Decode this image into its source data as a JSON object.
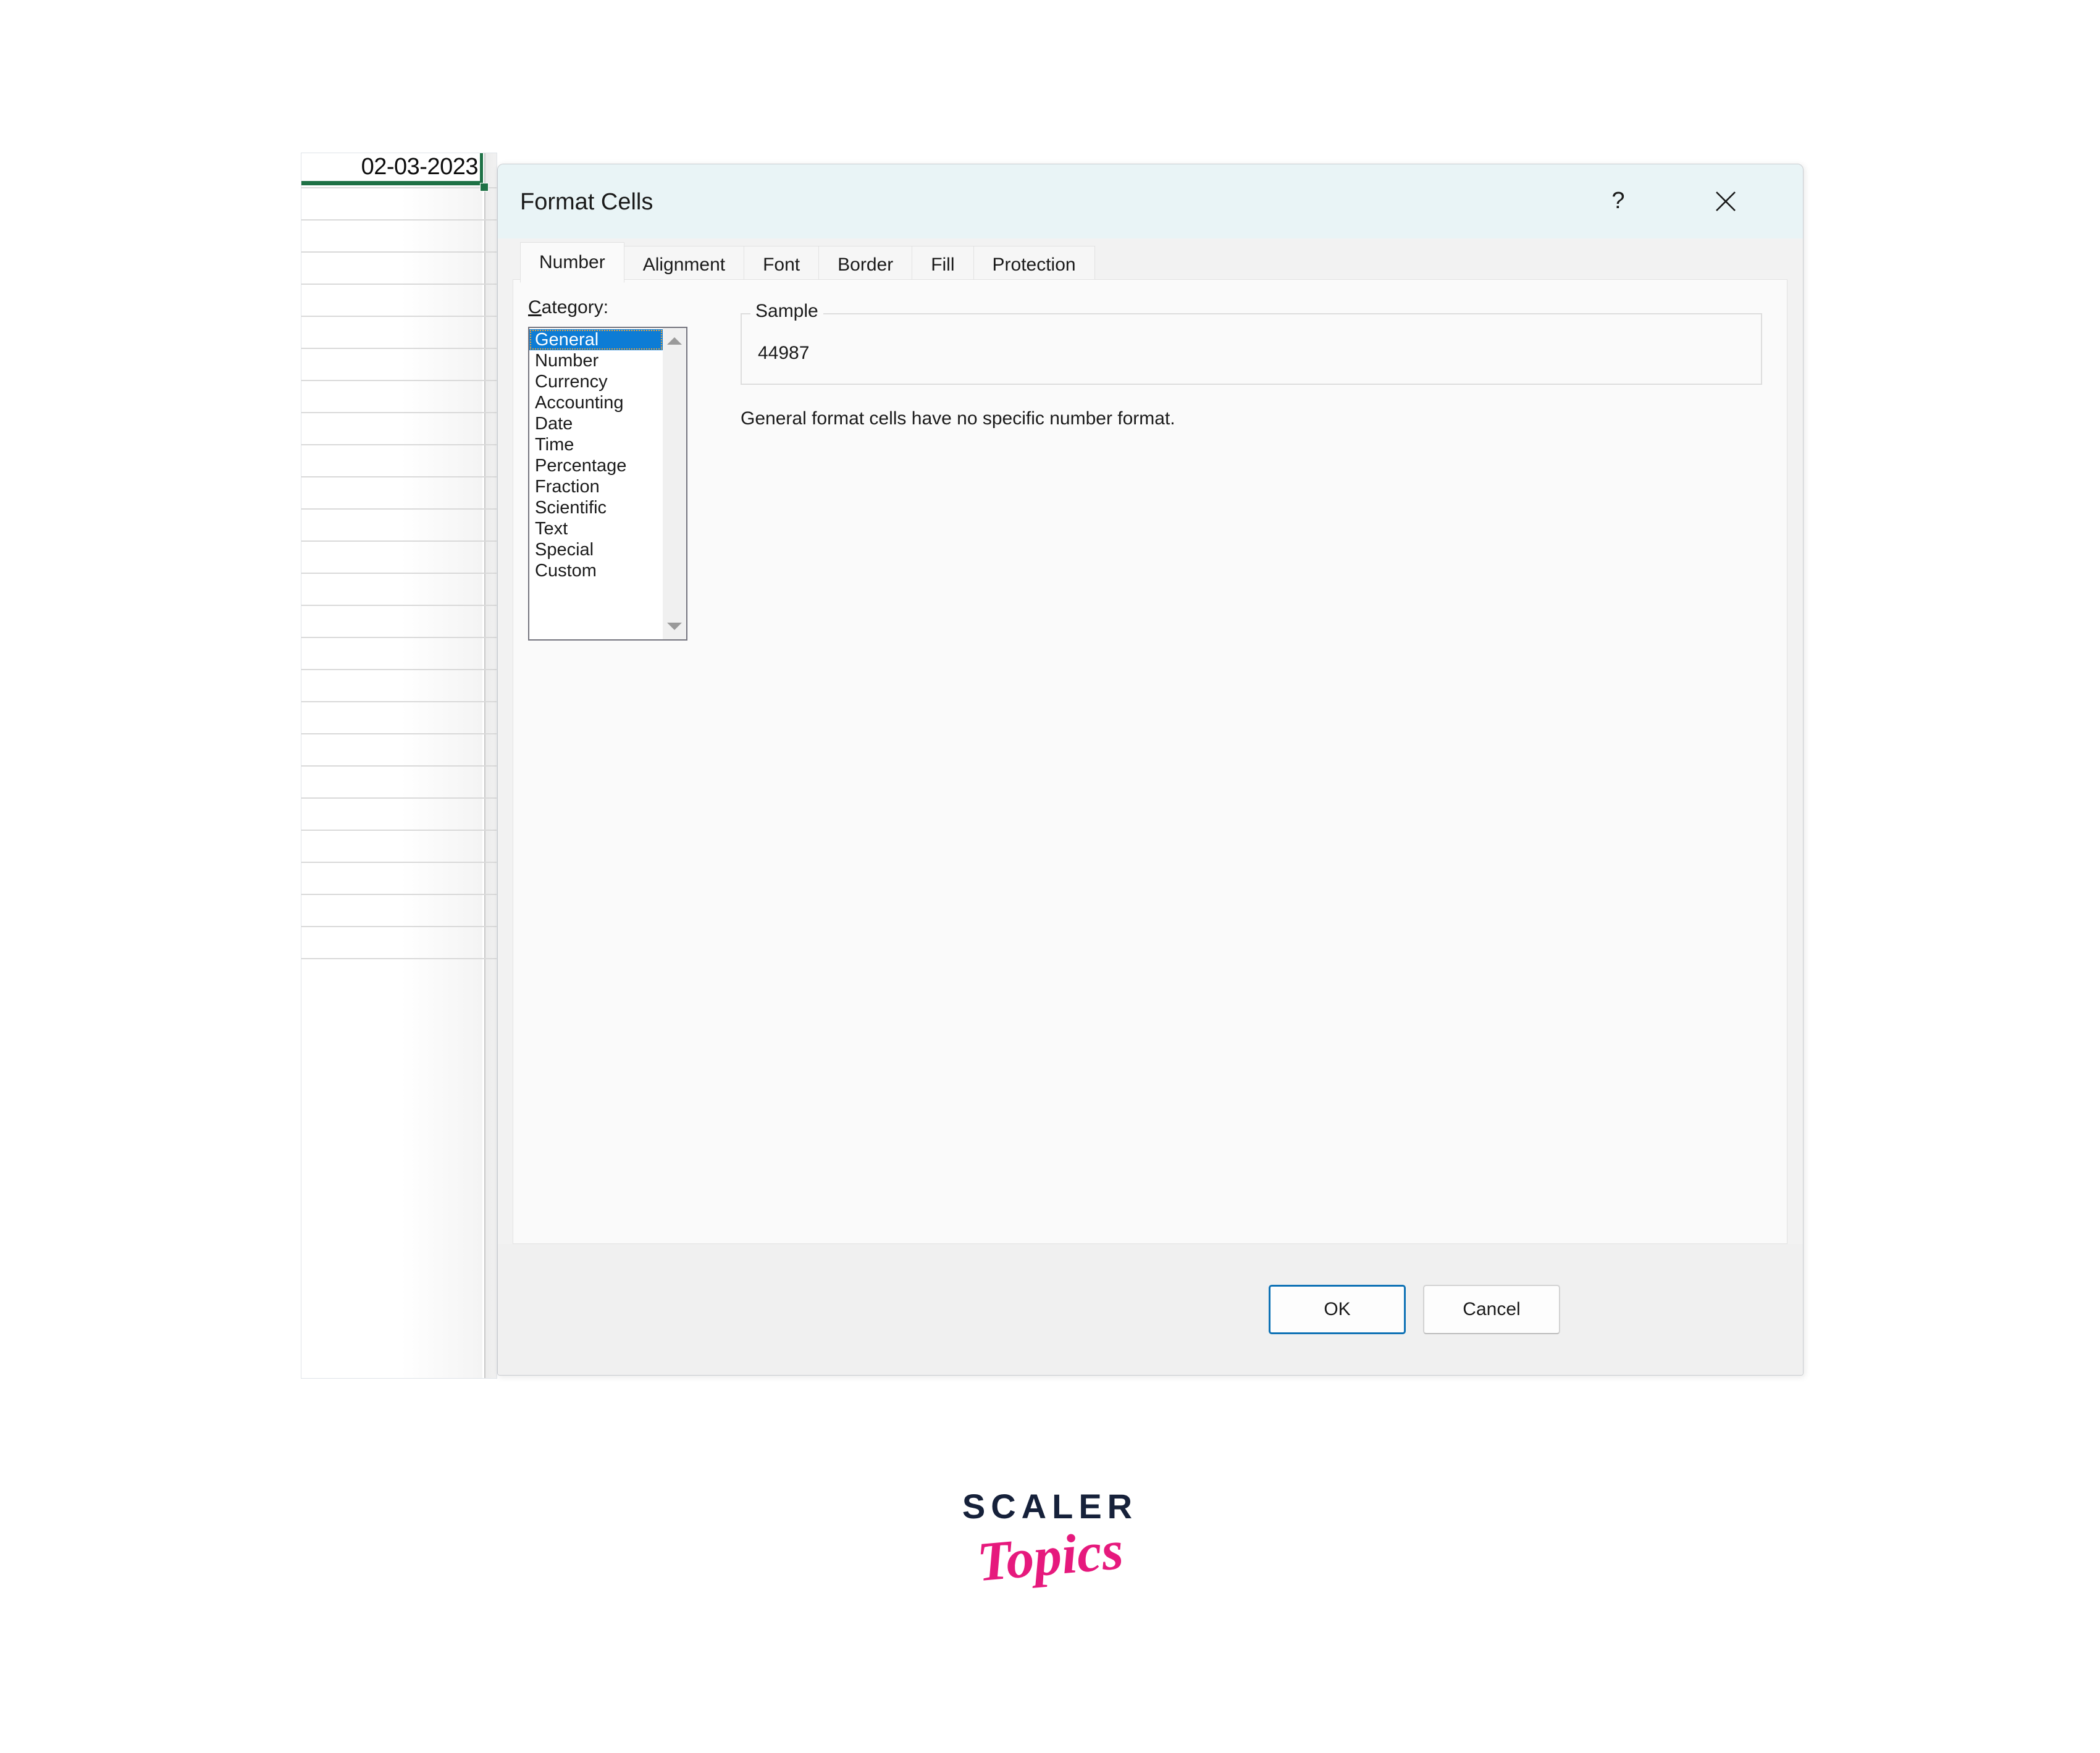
{
  "spreadsheet": {
    "selected_cell_value": "02-03-2023",
    "visible_row_count": 25
  },
  "dialog": {
    "title": "Format Cells",
    "help_icon": "question-mark-icon",
    "close_icon": "close-x-icon",
    "tabs": [
      {
        "label": "Number",
        "active": true
      },
      {
        "label": "Alignment",
        "active": false
      },
      {
        "label": "Font",
        "active": false
      },
      {
        "label": "Border",
        "active": false
      },
      {
        "label": "Fill",
        "active": false
      },
      {
        "label": "Protection",
        "active": false
      }
    ],
    "number_tab": {
      "category_label_accel": "C",
      "category_label_rest": "ategory:",
      "categories": [
        "General",
        "Number",
        "Currency",
        "Accounting",
        "Date",
        "Time",
        "Percentage",
        "Fraction",
        "Scientific",
        "Text",
        "Special",
        "Custom"
      ],
      "selected_category": "General",
      "sample": {
        "legend": "Sample",
        "value": "44987"
      },
      "description": "General format cells have no specific number format."
    },
    "buttons": {
      "ok": "OK",
      "cancel": "Cancel"
    }
  },
  "logo": {
    "primary": "SCALER",
    "secondary": "Topics"
  },
  "colors": {
    "titlebar": "#e9f4f6",
    "selection_blue": "#0d7cd5",
    "cell_border_green": "#1e7145",
    "default_button_border": "#0f72b5",
    "logo_primary": "#16213a",
    "logo_secondary": "#e6197d"
  }
}
